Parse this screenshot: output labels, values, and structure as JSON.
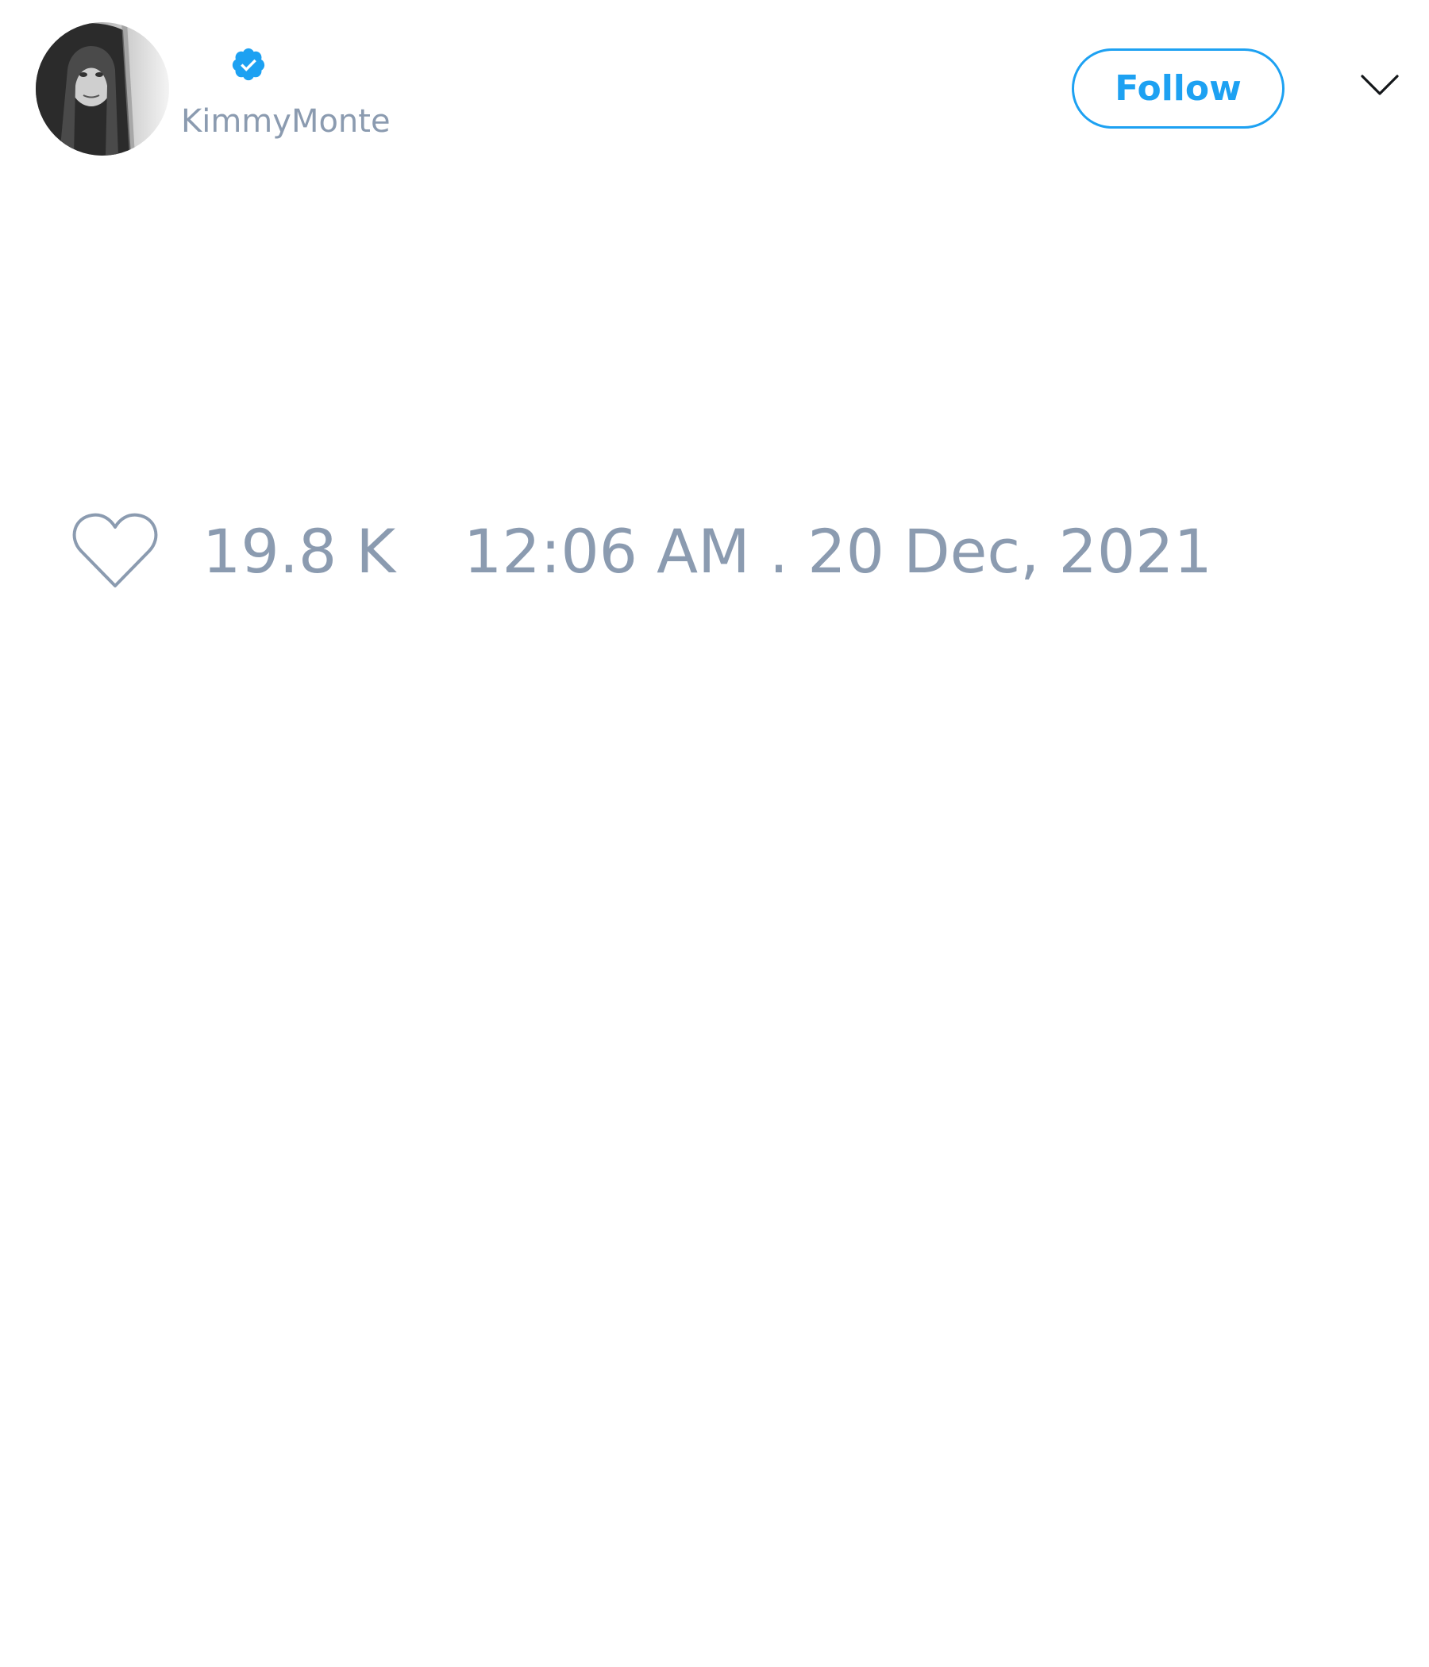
{
  "tweet": {
    "author": {
      "username": "KimmyMonte",
      "verified": true,
      "verified_badge_icon": "verified-badge-icon",
      "avatar": "profile-avatar"
    },
    "actions": {
      "follow_label": "Follow",
      "more_icon": "chevron-down-icon"
    },
    "stats": {
      "like_icon": "heart-icon",
      "likes": "19.8 K",
      "timestamp": "12:06 AM . 20 Dec, 2021"
    }
  },
  "colors": {
    "accent": "#1da1f2",
    "muted_text": "#8b9bb0",
    "background": "#ffffff"
  }
}
